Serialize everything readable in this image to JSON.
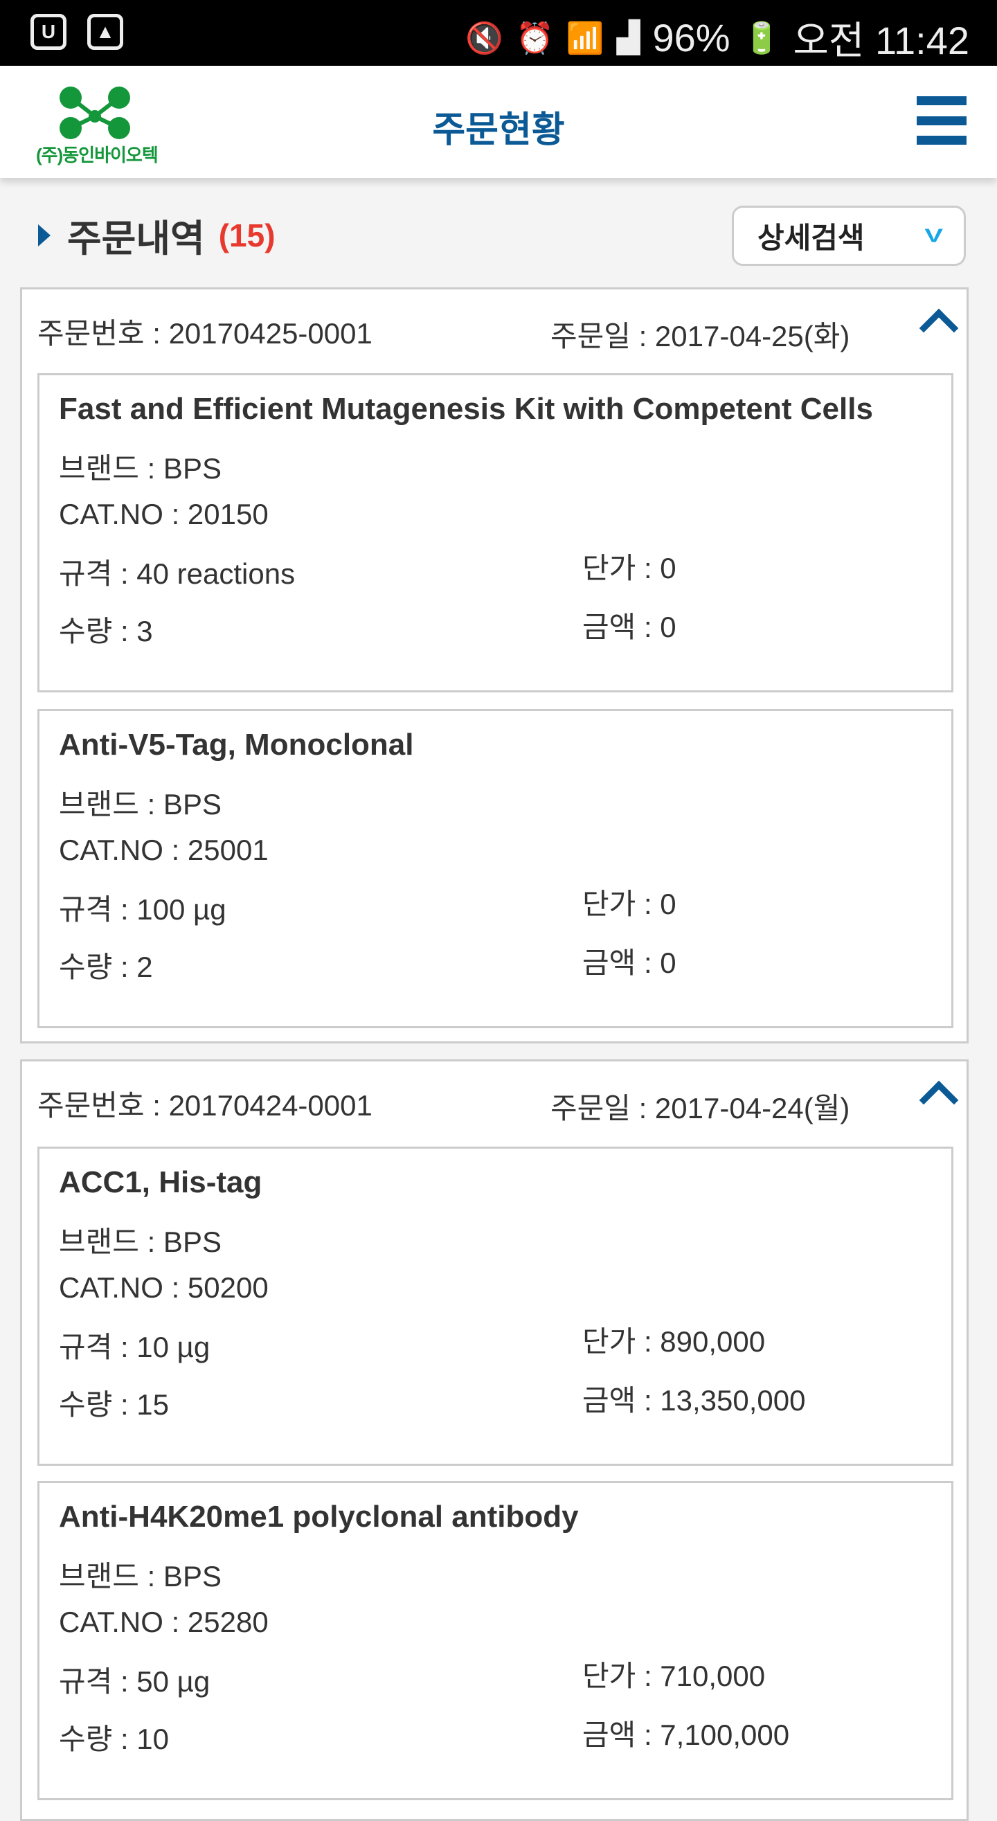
{
  "status_bar": {
    "battery": "96%",
    "time": "오전 11:42"
  },
  "header": {
    "logo_text": "(주)동인바이오텍",
    "title": "주문현황"
  },
  "section": {
    "title": "주문내역",
    "count": "(15)",
    "search_button": "상세검색"
  },
  "orders": [
    {
      "order_no": "주문번호 : 20170425-0001",
      "order_date": "주문일 : 2017-04-25(화)",
      "items": [
        {
          "name": "Fast and Efficient Mutagenesis Kit with Competent Cells",
          "brand": "브랜드 : BPS",
          "cat_no": "CAT.NO : 20150",
          "spec": "규격 : 40 reactions",
          "qty": "수량 : 3",
          "unit_price": "단가 : 0",
          "amount": "금액 : 0"
        },
        {
          "name": "Anti-V5-Tag, Monoclonal",
          "brand": "브랜드 : BPS",
          "cat_no": "CAT.NO : 25001",
          "spec": "규격 : 100 µg",
          "qty": "수량 : 2",
          "unit_price": "단가 : 0",
          "amount": "금액 : 0"
        }
      ]
    },
    {
      "order_no": "주문번호 : 20170424-0001",
      "order_date": "주문일 : 2017-04-24(월)",
      "items": [
        {
          "name": "ACC1, His-tag",
          "brand": "브랜드 : BPS",
          "cat_no": "CAT.NO : 50200",
          "spec": "규격 : 10 µg",
          "qty": "수량 : 15",
          "unit_price": "단가 : 890,000",
          "amount": "금액 : 13,350,000"
        },
        {
          "name": "Anti-H4K20me1 polyclonal antibody",
          "brand": "브랜드 : BPS",
          "cat_no": "CAT.NO : 25280",
          "spec": "규격 : 50 µg",
          "qty": "수량 : 10",
          "unit_price": "단가 : 710,000",
          "amount": "금액 : 7,100,000"
        }
      ]
    }
  ]
}
